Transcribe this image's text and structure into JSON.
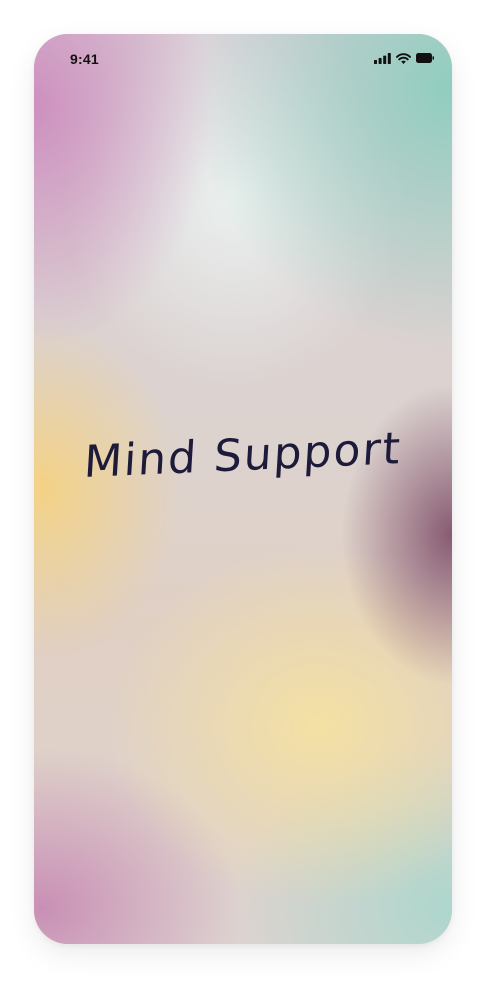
{
  "status_bar": {
    "time": "9:41",
    "icons": [
      "signal-icon",
      "wifi-icon",
      "battery-icon"
    ]
  },
  "splash": {
    "title": "Mind Support"
  },
  "colors": {
    "title_text": "#1d1a3a",
    "status_text": "#111111",
    "gradient_pink": "#cd8cbe",
    "gradient_mint": "#8ccdbe",
    "gradient_yellow": "#f5d282",
    "gradient_plum": "#784664"
  }
}
